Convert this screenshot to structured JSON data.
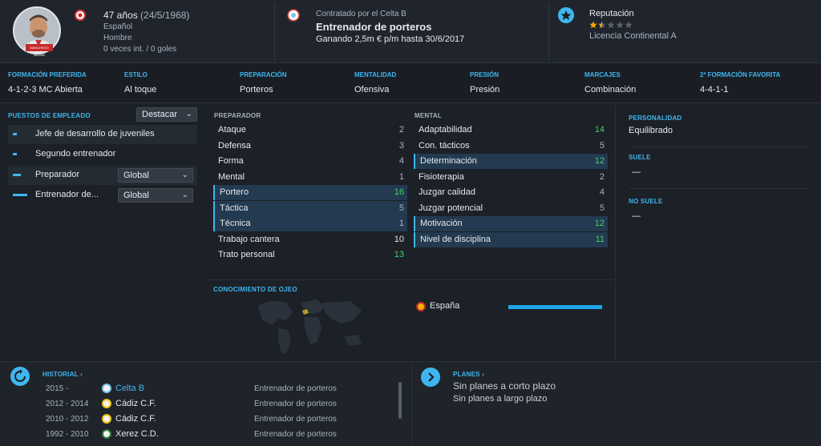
{
  "header": {
    "age": "47 años",
    "dob": "(24/5/1968)",
    "nationality": "Español",
    "gender": "Hombre",
    "intl": "0 veces int. / 0 goles",
    "contract_label": "Contratado por el Celta B",
    "role_title": "Entrenador de porteros",
    "wage": "Ganando 2,5m € p/m hasta 30/6/2017",
    "reputation_label": "Reputación",
    "reputation_stars": 1.5,
    "license": "Licencia Continental A",
    "ribbon_text": "MANCHEGO BAZAN"
  },
  "infobar": [
    {
      "label": "Formación preferida",
      "value": "4-1-2-3 MC Abierta"
    },
    {
      "label": "Estilo",
      "value": "Al toque"
    },
    {
      "label": "Preparación",
      "value": "Porteros"
    },
    {
      "label": "Mentalidad",
      "value": "Ofensiva"
    },
    {
      "label": "Presión",
      "value": "Presión"
    },
    {
      "label": "Marcajes",
      "value": "Combinación"
    },
    {
      "label": "2ª formación favorita",
      "value": "4-4-1-1"
    }
  ],
  "roles": {
    "title": "Puestos de empleado",
    "sort_dropdown": "Destacar",
    "items": [
      {
        "label": "Jefe de desarrollo de juveniles",
        "bar": 0.25,
        "dropdown": ""
      },
      {
        "label": "Segundo entrenador",
        "bar": 0.25,
        "dropdown": ""
      },
      {
        "label": "Preparador",
        "bar": 0.5,
        "dropdown": "Global"
      },
      {
        "label": "Entrenador de...",
        "bar": 0.85,
        "dropdown": "Global"
      }
    ]
  },
  "attributes": {
    "coach_title": "Preparador",
    "mental_title": "Mental",
    "coach": [
      {
        "name": "Ataque",
        "value": "2",
        "hl": false
      },
      {
        "name": "Defensa",
        "value": "3",
        "hl": false
      },
      {
        "name": "Forma",
        "value": "4",
        "hl": false
      },
      {
        "name": "Mental",
        "value": "1",
        "hl": false
      },
      {
        "name": "Portero",
        "value": "16",
        "hl": true,
        "green": true
      },
      {
        "name": "Táctica",
        "value": "5",
        "hl": true
      },
      {
        "name": "Técnica",
        "value": "1",
        "hl": true
      },
      {
        "name": "Trabajo cantera",
        "value": "10",
        "hl": false,
        "bright": true
      },
      {
        "name": "Trato personal",
        "value": "13",
        "hl": false,
        "green": true
      }
    ],
    "mental": [
      {
        "name": "Adaptabilidad",
        "value": "14",
        "hl": false,
        "green": true
      },
      {
        "name": "Con. tácticos",
        "value": "5",
        "hl": false
      },
      {
        "name": "Determinación",
        "value": "12",
        "hl": true,
        "green": true
      },
      {
        "name": "Fisioterapia",
        "value": "2",
        "hl": false
      },
      {
        "name": "Juzgar calidad",
        "value": "4",
        "hl": false
      },
      {
        "name": "Juzgar potencial",
        "value": "5",
        "hl": false
      },
      {
        "name": "Motivación",
        "value": "12",
        "hl": true,
        "green": true
      },
      {
        "name": "Nivel de disciplina",
        "value": "11",
        "hl": true,
        "green": true
      }
    ]
  },
  "scouting": {
    "title": "Conocimiento de ojeo",
    "country": "España",
    "knowledge": 1.0
  },
  "personality": {
    "title": "Personalidad",
    "value": "Equilibrado",
    "usually_title": "Suele",
    "usually_value": "—",
    "never_title": "No suele",
    "never_value": "—"
  },
  "history": {
    "title": "Historial",
    "rows": [
      {
        "years": "2015 -",
        "club": "Celta B",
        "role": "Entrenador de porteros",
        "current": true,
        "crest": "#7ec6ee"
      },
      {
        "years": "2012 - 2014",
        "club": "Cádiz C.F.",
        "role": "Entrenador de porteros",
        "current": false,
        "crest": "#f2c500"
      },
      {
        "years": "2010 - 2012",
        "club": "Cádiz C.F.",
        "role": "Entrenador de porteros",
        "current": false,
        "crest": "#f2c500"
      },
      {
        "years": "1992 - 2010",
        "club": "Xerez C.D.",
        "role": "Entrenador de porteros",
        "current": false,
        "crest": "#2e7d32"
      }
    ]
  },
  "plans": {
    "title": "Planes",
    "short": "Sin planes a corto plazo",
    "long": "Sin planes a largo plazo"
  },
  "colors": {
    "accent": "#3fb6ef",
    "good": "#44d36a",
    "star": "#f2a900"
  }
}
